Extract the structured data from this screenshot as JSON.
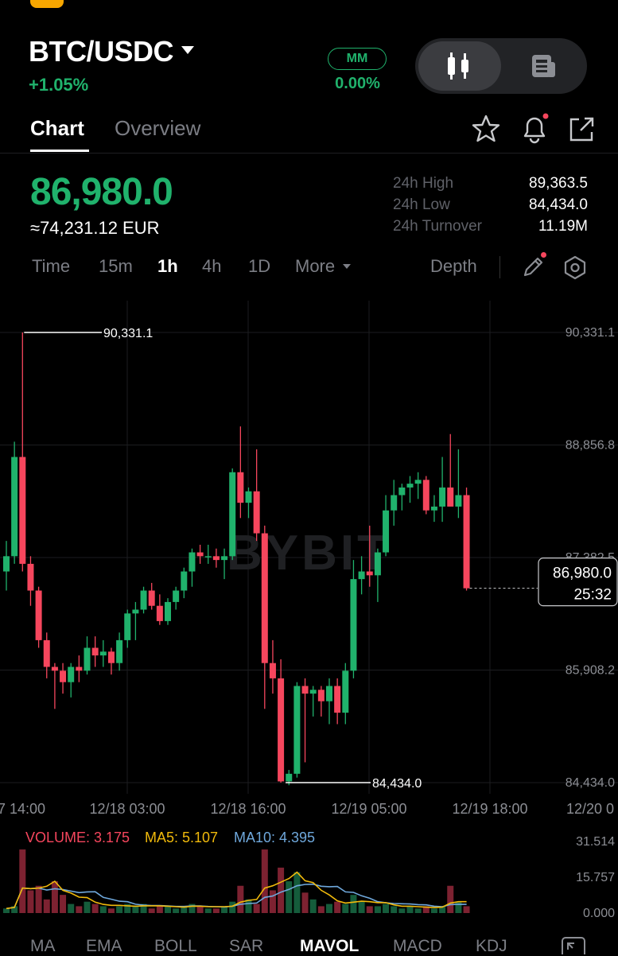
{
  "header": {
    "pair": "BTC/USDC",
    "change": "+1.05%",
    "mm_badge": "MM",
    "mm_value": "0.00%"
  },
  "tabs": {
    "chart": "Chart",
    "overview": "Overview"
  },
  "ticker": {
    "last_price": "86,980.0",
    "fiat_value": "≈74,231.12 EUR",
    "stats": [
      {
        "label": "24h High",
        "value": "89,363.5"
      },
      {
        "label": "24h Low",
        "value": "84,434.0"
      },
      {
        "label": "24h Turnover",
        "value": "11.19M"
      }
    ]
  },
  "timeframes": {
    "time": "Time",
    "m15": "15m",
    "h1": "1h",
    "h4": "4h",
    "d1": "1D",
    "more": "More",
    "depth": "Depth"
  },
  "chart_data": {
    "type": "candlestick",
    "watermark": "BYBIT",
    "price_axis": [
      "90,331.1",
      "88,856.8",
      "87,382.5",
      "85,908.2",
      "84,434.0"
    ],
    "time_axis": [
      "7 14:00",
      "12/18 03:00",
      "12/18 16:00",
      "12/19 05:00",
      "12/19 18:00",
      "12/20 0"
    ],
    "high_marker": "90,331.1",
    "low_marker": "84,434.0",
    "last_price": "86,980.0",
    "countdown": "25:32",
    "ylim": [
      84434.0,
      90331.1
    ],
    "up_color": "#20b26c",
    "down_color": "#f6465d",
    "candles": [
      [
        87200,
        87600,
        86950,
        87400
      ],
      [
        87400,
        88900,
        87300,
        88700
      ],
      [
        88700,
        90331.1,
        87200,
        87300
      ],
      [
        87300,
        87400,
        86750,
        86950
      ],
      [
        86950,
        87000,
        86200,
        86300
      ],
      [
        86300,
        86400,
        85800,
        85950
      ],
      [
        85950,
        86000,
        85400,
        85900
      ],
      [
        85900,
        86000,
        85600,
        85750
      ],
      [
        85750,
        86000,
        85550,
        85950
      ],
      [
        85950,
        86100,
        85750,
        85900
      ],
      [
        85900,
        86350,
        85850,
        86200
      ],
      [
        86200,
        86350,
        85950,
        86100
      ],
      [
        86100,
        86300,
        85950,
        86150
      ],
      [
        86150,
        86200,
        85850,
        86000
      ],
      [
        86000,
        86400,
        85900,
        86300
      ],
      [
        86300,
        86700,
        86200,
        86650
      ],
      [
        86650,
        86800,
        86300,
        86700
      ],
      [
        86700,
        87000,
        86650,
        86950
      ],
      [
        86950,
        87050,
        86700,
        86750
      ],
      [
        86750,
        86900,
        86500,
        86550
      ],
      [
        86550,
        86850,
        86500,
        86800
      ],
      [
        86800,
        87000,
        86700,
        86950
      ],
      [
        86950,
        87250,
        86850,
        87200
      ],
      [
        87200,
        87500,
        87000,
        87450
      ],
      [
        87450,
        87550,
        87300,
        87400
      ],
      [
        87400,
        87550,
        87300,
        87400
      ],
      [
        87400,
        87500,
        87250,
        87350
      ],
      [
        87350,
        87500,
        87100,
        87400
      ],
      [
        87400,
        88550,
        87350,
        88500
      ],
      [
        88500,
        89100,
        87900,
        88100
      ],
      [
        88100,
        88300,
        87900,
        88250
      ],
      [
        88250,
        88800,
        87600,
        87700
      ],
      [
        87700,
        87800,
        85400,
        86000
      ],
      [
        86000,
        86300,
        85600,
        85800
      ],
      [
        85800,
        86050,
        84434,
        84450
      ],
      [
        84450,
        84600,
        84400,
        84550
      ],
      [
        84550,
        85750,
        84500,
        85700
      ],
      [
        85700,
        85800,
        84700,
        85600
      ],
      [
        85600,
        85700,
        85300,
        85650
      ],
      [
        85650,
        85700,
        85300,
        85500
      ],
      [
        85500,
        85800,
        85200,
        85700
      ],
      [
        85700,
        85800,
        85200,
        85350
      ],
      [
        85350,
        86000,
        85200,
        85900
      ],
      [
        85900,
        87350,
        85800,
        87100
      ],
      [
        87100,
        87400,
        86900,
        87200
      ],
      [
        87200,
        87800,
        87000,
        87150
      ],
      [
        87150,
        87500,
        86800,
        87450
      ],
      [
        87450,
        88200,
        87400,
        88000
      ],
      [
        88000,
        88400,
        87800,
        88200
      ],
      [
        88200,
        88350,
        88000,
        88300
      ],
      [
        88300,
        88450,
        88100,
        88350
      ],
      [
        88350,
        88500,
        88150,
        88400
      ],
      [
        88400,
        88450,
        87950,
        88000
      ],
      [
        88000,
        88200,
        87850,
        88050
      ],
      [
        88050,
        88700,
        87850,
        88300
      ],
      [
        88300,
        89000,
        88100,
        88050
      ],
      [
        88050,
        88800,
        87900,
        88200
      ],
      [
        88200,
        88300,
        86950,
        86980
      ]
    ],
    "volume": {
      "label": "VOLUME: 3.175",
      "ma5_label": "MA5: 5.107",
      "ma10_label": "MA10: 4.395",
      "axis": [
        "31.514",
        "15.757",
        "0.000"
      ],
      "ma5_color": "#f0b90b",
      "ma10_color": "#6fa8dc",
      "values": [
        2,
        3,
        28,
        10,
        12,
        6,
        14,
        8,
        4,
        3,
        5,
        4,
        3,
        2,
        3,
        4,
        3,
        4,
        2,
        3,
        3,
        2,
        3,
        4,
        3,
        2,
        2,
        3,
        5,
        12,
        6,
        4,
        28,
        10,
        20,
        14,
        18,
        9,
        6,
        3,
        4,
        5,
        4,
        8,
        5,
        3,
        3,
        4,
        3,
        2,
        3,
        2,
        3,
        2,
        3,
        12,
        5,
        3
      ]
    }
  },
  "indicators": [
    "MA",
    "EMA",
    "BOLL",
    "SAR",
    "MAVOL",
    "MACD",
    "KDJ"
  ],
  "active_indicator": "MAVOL"
}
